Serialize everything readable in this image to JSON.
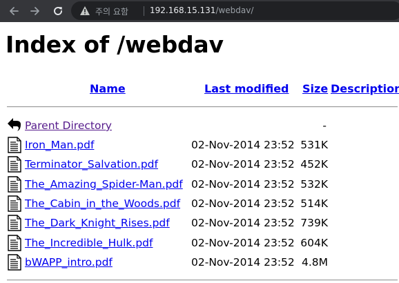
{
  "browser": {
    "security_label": "주의 요함",
    "url_host": "192.168.15.131",
    "url_path": "/webdav/"
  },
  "page": {
    "title": "Index of /webdav"
  },
  "columns": {
    "name": "Name",
    "last_modified": "Last modified",
    "size": "Size",
    "description": "Description"
  },
  "parent": {
    "name": "Parent Directory",
    "size": "-",
    "icon": "back-arrow-icon"
  },
  "files": [
    {
      "name": "Iron_Man.pdf",
      "modified": "02-Nov-2014 23:52",
      "size": "531K",
      "icon": "document-icon"
    },
    {
      "name": "Terminator_Salvation.pdf",
      "modified": "02-Nov-2014 23:52",
      "size": "452K",
      "icon": "document-icon"
    },
    {
      "name": "The_Amazing_Spider-Man.pdf",
      "modified": "02-Nov-2014 23:52",
      "size": "532K",
      "icon": "document-icon"
    },
    {
      "name": "The_Cabin_in_the_Woods.pdf",
      "modified": "02-Nov-2014 23:52",
      "size": "514K",
      "icon": "document-icon"
    },
    {
      "name": "The_Dark_Knight_Rises.pdf",
      "modified": "02-Nov-2014 23:52",
      "size": "739K",
      "icon": "document-icon"
    },
    {
      "name": "The_Incredible_Hulk.pdf",
      "modified": "02-Nov-2014 23:52",
      "size": "604K",
      "icon": "document-icon"
    },
    {
      "name": "bWAPP_intro.pdf",
      "modified": "02-Nov-2014 23:52",
      "size": "4.8M",
      "icon": "document-icon"
    }
  ],
  "colors": {
    "toolbar_bg": "#35363a",
    "omnibox_bg": "#202124",
    "link": "#0000ee",
    "visited_link": "#551a8b"
  }
}
